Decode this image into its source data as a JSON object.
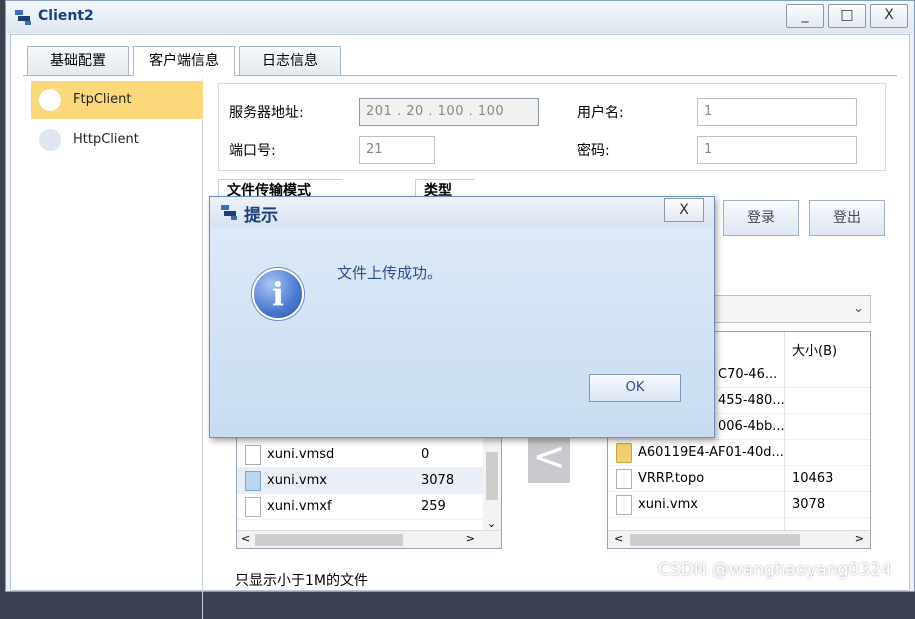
{
  "window": {
    "title": "Client2",
    "min_label": "_",
    "max_label": "□",
    "close_label": "X"
  },
  "tabs": [
    {
      "label": "基础配置"
    },
    {
      "label": "客户端信息"
    },
    {
      "label": "日志信息"
    }
  ],
  "sidebar": {
    "items": [
      {
        "label": "FtpClient",
        "selected": true
      },
      {
        "label": "HttpClient",
        "selected": false
      }
    ]
  },
  "server": {
    "addr_label": "服务器地址:",
    "addr_value": "201 . 20 . 100 . 100",
    "port_label": "端口号:",
    "port_value": "21",
    "user_label": "用户名:",
    "user_value": "1",
    "pwd_label": "密码:",
    "pwd_value": "1"
  },
  "transfer": {
    "mode_label": "文件传输模式",
    "type_label": "类型",
    "login_label": "登录",
    "logout_label": "登出"
  },
  "local_files": [
    {
      "name": "xuni.vmsd",
      "size": "0",
      "icon": "file-icon"
    },
    {
      "name": "xuni.vmx",
      "size": "3078",
      "icon": "vmx-file-icon"
    },
    {
      "name": "xuni.vmxf",
      "size": "259",
      "icon": "file-icon"
    }
  ],
  "remote": {
    "size_header": "大小(B)",
    "files": [
      {
        "name": "C70-46...",
        "size": ""
      },
      {
        "name": "455-480...",
        "size": ""
      },
      {
        "name": "006-4bb...",
        "size": ""
      },
      {
        "name": "A60119E4-AF01-40d...",
        "size": "",
        "icon": "folder-icon"
      },
      {
        "name": "VRRP.topo",
        "size": "10463",
        "icon": "file-icon"
      },
      {
        "name": "xuni.vmx",
        "size": "3078",
        "icon": "file-icon"
      }
    ]
  },
  "footer": {
    "filter_label": "只显示小于1M的文件"
  },
  "dialog": {
    "title": "提示",
    "close_label": "X",
    "message": "文件上传成功。",
    "ok_label": "OK"
  },
  "watermark": "CSDN @wanghaoyang0324",
  "colors": {
    "selected_item": "#fbd97a",
    "title_text": "#1a3f7a",
    "dialog_bg": "#cfdff1"
  }
}
